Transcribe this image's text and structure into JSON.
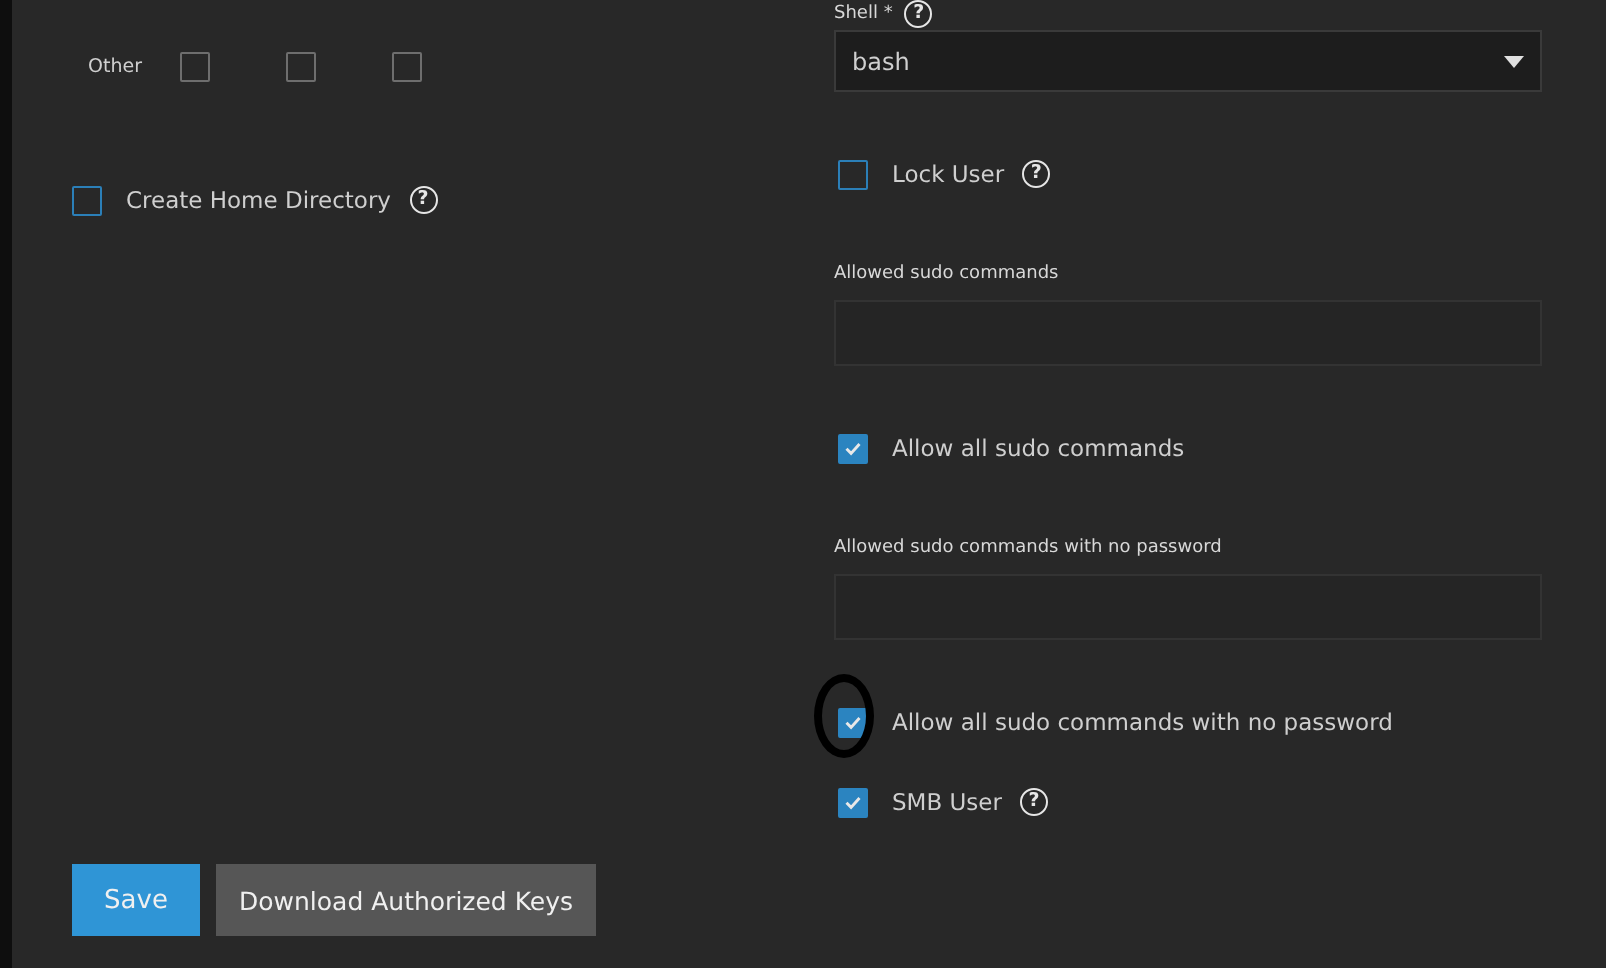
{
  "permissions": {
    "label": "Other",
    "boxes": [
      {
        "checked": false
      },
      {
        "checked": false
      },
      {
        "checked": false
      }
    ]
  },
  "create_home": {
    "label": "Create Home Directory",
    "checked": false,
    "help": "?"
  },
  "shell": {
    "label": "Shell *",
    "value": "bash",
    "help": "?"
  },
  "right_items": [
    {
      "kind": "checkbox",
      "label": "Lock User",
      "checked": false,
      "help": "?",
      "highlighted": false
    },
    {
      "kind": "textarea",
      "label": "Allowed sudo commands"
    },
    {
      "kind": "checkbox",
      "label": "Allow all sudo commands",
      "checked": true,
      "highlighted": false
    },
    {
      "kind": "textarea",
      "label": "Allowed sudo commands with no password"
    },
    {
      "kind": "checkbox",
      "label": "Allow all sudo commands with no password",
      "checked": true,
      "highlighted": true
    },
    {
      "kind": "checkbox",
      "label": "SMB User",
      "checked": true,
      "help": "?",
      "highlighted": false
    }
  ],
  "buttons": [
    {
      "label": "Save",
      "kind": "primary"
    },
    {
      "label": "Download Authorized Keys",
      "kind": "secondary"
    }
  ]
}
